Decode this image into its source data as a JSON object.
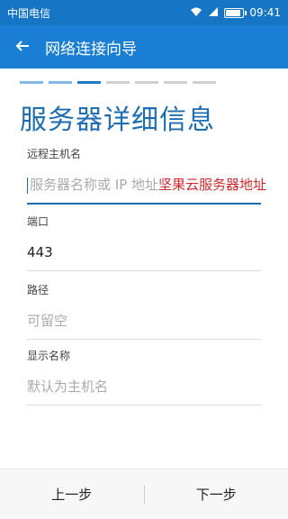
{
  "status": {
    "carrier": "中国电信",
    "time": "09:41"
  },
  "app_bar": {
    "title": "网络连接向导"
  },
  "progress": {
    "total_steps": 7,
    "current_step": 3
  },
  "heading": "服务器详细信息",
  "fields": [
    {
      "label": "远程主机名",
      "placeholder": "服务器名称或 IP 地址",
      "hint": "坚果云服务器地址"
    },
    {
      "label": "端口",
      "value": "443"
    },
    {
      "label": "路径",
      "placeholder": "可留空"
    },
    {
      "label": "显示名称",
      "placeholder": "默认为主机名"
    }
  ],
  "bottom": {
    "prev": "上一步",
    "next": "下一步"
  }
}
